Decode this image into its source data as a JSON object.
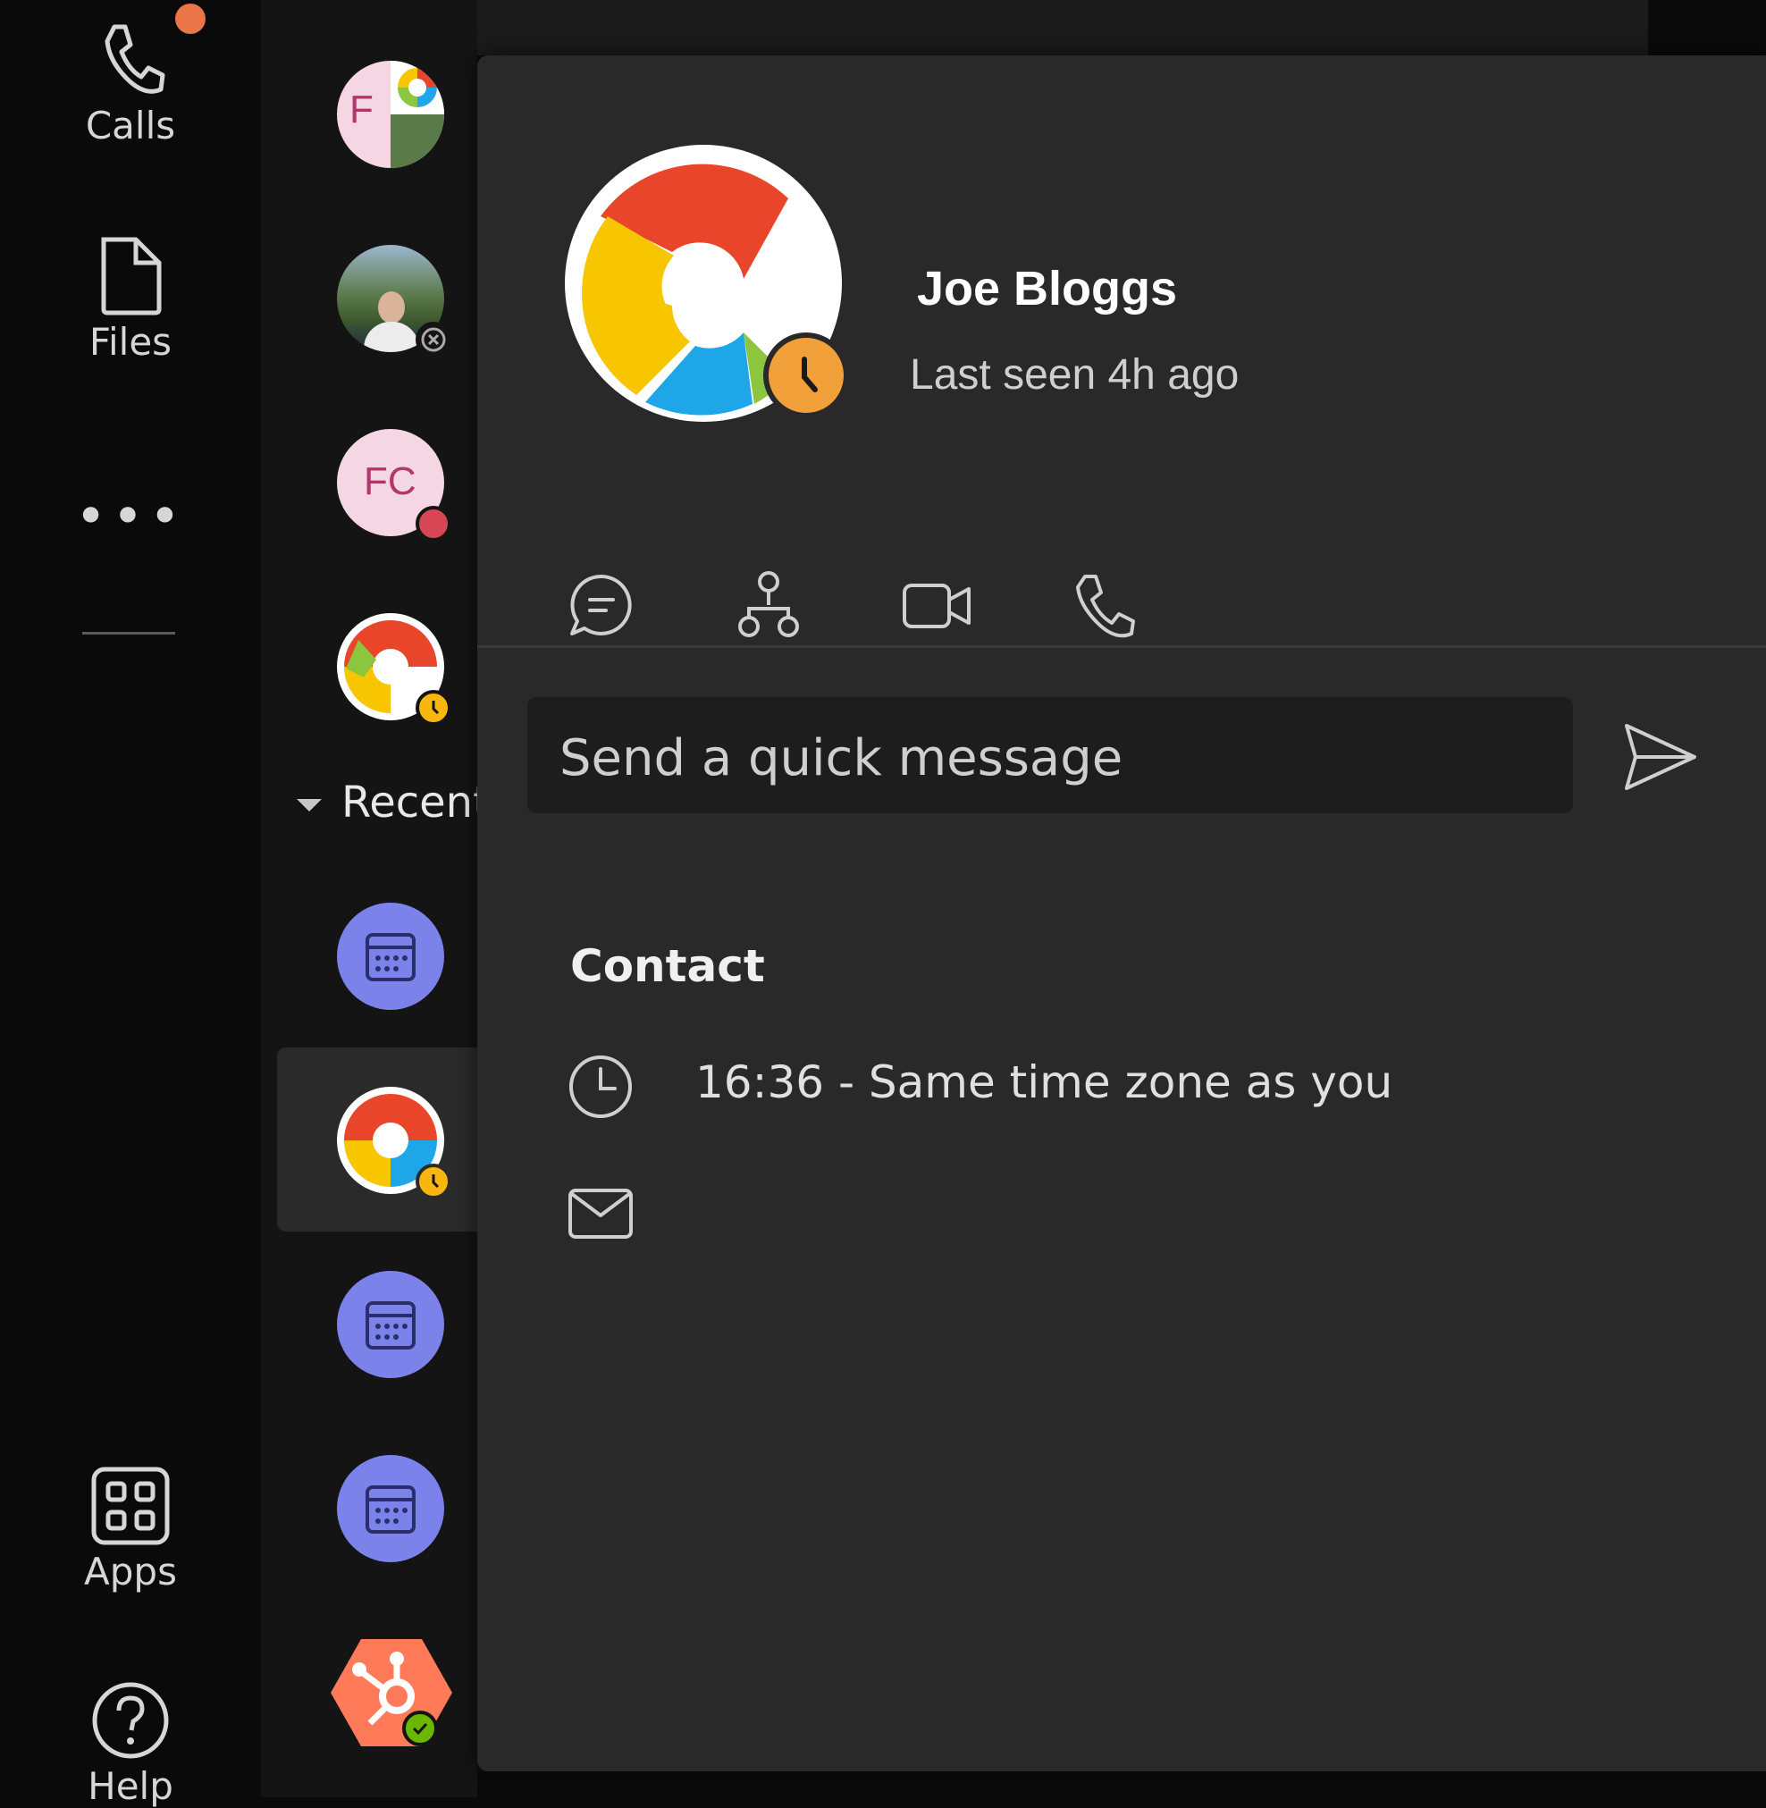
{
  "rail": {
    "calls_label": "Calls",
    "files_label": "Files",
    "more_label": "•••",
    "apps_label": "Apps",
    "help_label": "Help"
  },
  "list": {
    "section_label": "Recent",
    "avatar_initials": [
      "F",
      "FC"
    ]
  },
  "profile": {
    "name": "Joe Bloggs",
    "last_seen": "Last seen 4h ago",
    "message_placeholder": "Send a quick message",
    "contact_heading": "Contact",
    "local_time": "16:36 - Same time zone as you"
  },
  "colors": {
    "accent_purple": "#7b83eb",
    "status_away": "#f2a03a",
    "status_busy": "#d74654",
    "status_available": "#6bb700",
    "notification": "#e97548"
  }
}
